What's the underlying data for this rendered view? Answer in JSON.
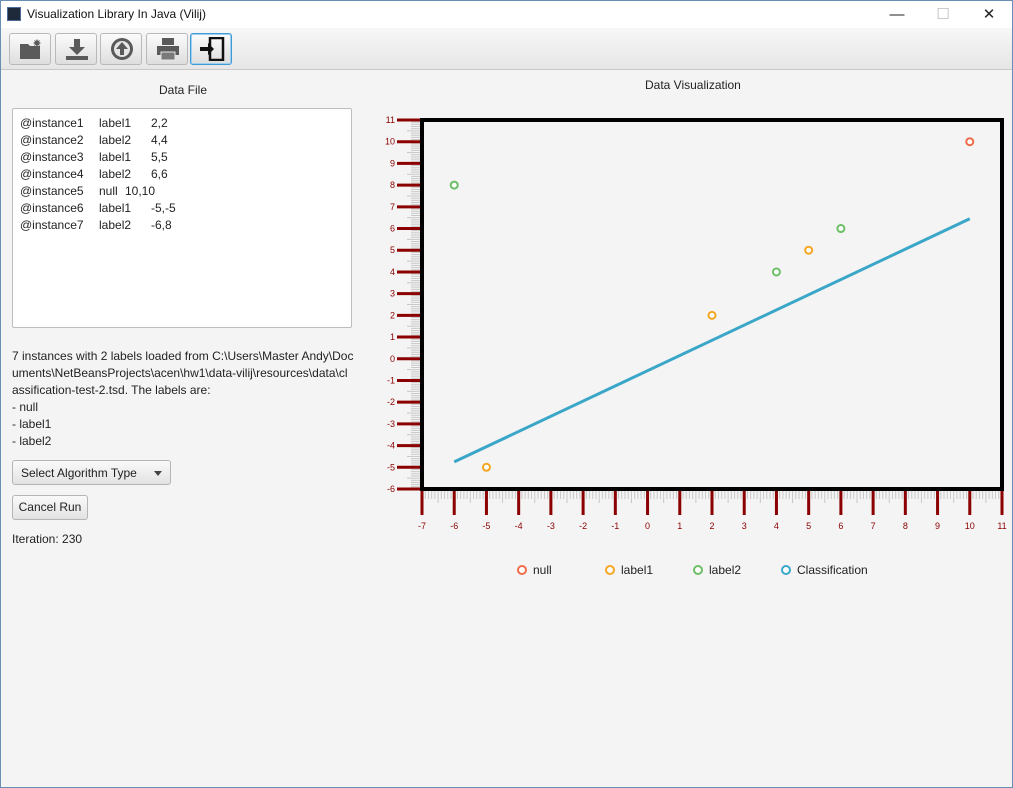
{
  "window": {
    "title": "Visualization Library In Java (Vilij)",
    "minimize": "—",
    "maximize": "☐",
    "close": "✕"
  },
  "toolbar": {
    "buttons": [
      {
        "name": "new-icon"
      },
      {
        "name": "save-icon"
      },
      {
        "name": "load-icon"
      },
      {
        "name": "print-icon"
      },
      {
        "name": "exit-icon"
      }
    ]
  },
  "left": {
    "title": "Data File",
    "rows": [
      {
        "id": "@instance1",
        "label": "label1",
        "value": "2,2"
      },
      {
        "id": "@instance2",
        "label": "label2",
        "value": "4,4"
      },
      {
        "id": "@instance3",
        "label": "label1",
        "value": "5,5"
      },
      {
        "id": "@instance4",
        "label": "label2",
        "value": "6,6"
      },
      {
        "id": "@instance5",
        "label": "null",
        "value": "10,10"
      },
      {
        "id": "@instance6",
        "label": "label1",
        "value": "-5,-5"
      },
      {
        "id": "@instance7",
        "label": "label2",
        "value": "-6,8"
      }
    ],
    "info_lines": [
      "7 instances with 2 labels loaded from C:\\Users\\Master Andy\\Documents\\NetBeansProjects\\acen\\hw1\\data-vilij\\resources\\data\\classification-test-2.tsd. The labels are:",
      "- null",
      "- label1",
      "- label2"
    ],
    "algorithm_select": "Select Algorithm Type",
    "cancel_button": "Cancel Run",
    "iteration": "Iteration: 230"
  },
  "chart_data": {
    "type": "scatter",
    "title": "Data Visualization",
    "xlim": [
      -7,
      11
    ],
    "ylim": [
      -6,
      11
    ],
    "xticks": [
      "-7",
      "-6",
      "-5",
      "-4",
      "-3",
      "-2",
      "-1",
      "0",
      "1",
      "2",
      "3",
      "4",
      "5",
      "6",
      "7",
      "8",
      "9",
      "10",
      "11"
    ],
    "yticks": [
      "-6",
      "-5",
      "-4",
      "-3",
      "-2",
      "-1",
      "0",
      "1",
      "2",
      "3",
      "4",
      "5",
      "6",
      "7",
      "8",
      "9",
      "10",
      "11"
    ],
    "series": [
      {
        "name": "null",
        "color": "#ef6c4a",
        "points": [
          [
            10,
            10
          ]
        ]
      },
      {
        "name": "label1",
        "color": "#f5a623",
        "points": [
          [
            2,
            2
          ],
          [
            5,
            5
          ],
          [
            -5,
            -5
          ]
        ]
      },
      {
        "name": "label2",
        "color": "#6dbf67",
        "points": [
          [
            4,
            4
          ],
          [
            6,
            6
          ],
          [
            -6,
            8
          ]
        ]
      }
    ],
    "line": {
      "name": "Classification",
      "color": "#3aa6c8",
      "points": [
        [
          -6,
          -4.75
        ],
        [
          10,
          6.45
        ]
      ]
    },
    "tick_color": "#8b0000"
  }
}
